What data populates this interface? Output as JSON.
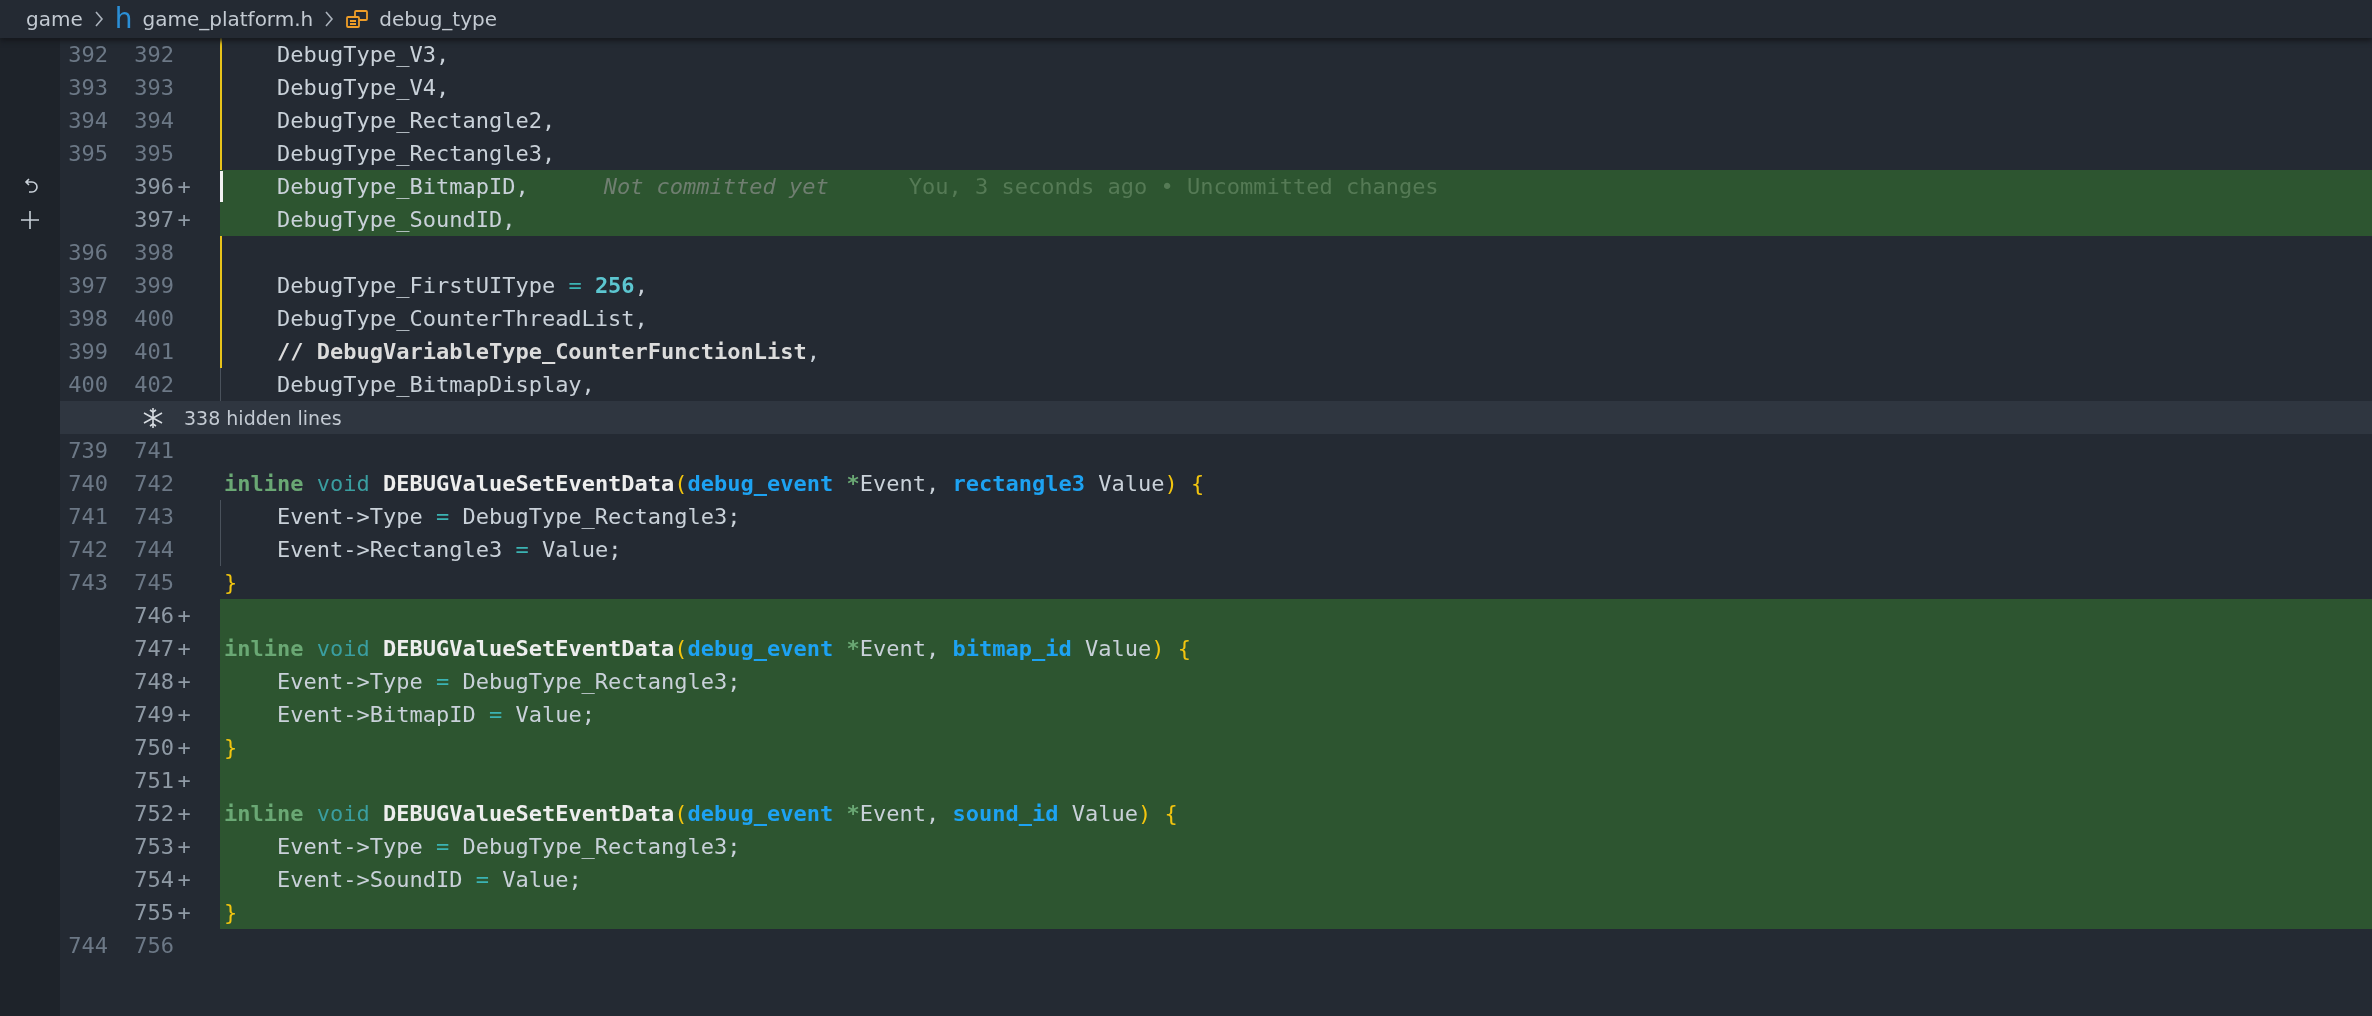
{
  "breadcrumb": [
    {
      "kind": "folder",
      "label": "game"
    },
    {
      "kind": "file",
      "icon_text": "h",
      "label": "game_platform.h"
    },
    {
      "kind": "symbol",
      "label": "debug_type"
    }
  ],
  "rows": [
    {
      "kind": "line",
      "old": "392",
      "new": "392",
      "added": false,
      "modified": true,
      "tokens": [
        {
          "kind": "plain",
          "text": "    DebugType_V3,"
        }
      ]
    },
    {
      "kind": "line",
      "old": "393",
      "new": "393",
      "added": false,
      "modified": true,
      "tokens": [
        {
          "kind": "plain",
          "text": "    DebugType_V4,"
        }
      ]
    },
    {
      "kind": "line",
      "old": "394",
      "new": "394",
      "added": false,
      "modified": true,
      "tokens": [
        {
          "kind": "plain",
          "text": "    DebugType_Rectangle2,"
        }
      ]
    },
    {
      "kind": "line",
      "old": "395",
      "new": "395",
      "added": false,
      "modified": true,
      "tokens": [
        {
          "kind": "plain",
          "text": "    DebugType_Rectangle3,"
        }
      ]
    },
    {
      "kind": "line",
      "new": "396",
      "sign": "+",
      "added": true,
      "cursor": true,
      "revert_action": true,
      "tokens": [
        {
          "kind": "plain",
          "text": "    DebugType_BitmapID,"
        }
      ],
      "blame": {
        "label": "Not committed yet",
        "detail": "You, 3 seconds ago • Uncommitted changes"
      }
    },
    {
      "kind": "line",
      "new": "397",
      "sign": "+",
      "added": true,
      "stage_action": true,
      "tokens": [
        {
          "kind": "plain",
          "text": "    DebugType_SoundID,"
        }
      ]
    },
    {
      "kind": "line",
      "old": "396",
      "new": "398",
      "added": false,
      "modified": true
    },
    {
      "kind": "line",
      "old": "397",
      "new": "399",
      "added": false,
      "modified": true,
      "tokens": [
        {
          "kind": "plain",
          "text": "    DebugType_FirstUIType "
        },
        {
          "kind": "op",
          "text": "= "
        },
        {
          "kind": "number",
          "text": "256"
        },
        {
          "kind": "plain",
          "text": ","
        }
      ]
    },
    {
      "kind": "line",
      "old": "398",
      "new": "400",
      "added": false,
      "modified": true,
      "tokens": [
        {
          "kind": "plain",
          "text": "    DebugType_CounterThreadList,"
        }
      ]
    },
    {
      "kind": "line",
      "old": "399",
      "new": "401",
      "added": false,
      "modified": true,
      "tokens": [
        {
          "kind": "comment",
          "text": "    // DebugVariableType_CounterFunctionList"
        },
        {
          "kind": "plain",
          "text": ","
        }
      ]
    },
    {
      "kind": "line",
      "old": "400",
      "new": "402",
      "added": false,
      "indent_guide": true,
      "tokens": [
        {
          "kind": "plain",
          "text": "    DebugType_BitmapDisplay,"
        }
      ]
    },
    {
      "kind": "fold",
      "label": "338 hidden lines"
    },
    {
      "kind": "line",
      "old": "739",
      "new": "741",
      "added": false
    },
    {
      "kind": "line",
      "old": "740",
      "new": "742",
      "added": false,
      "tokens": [
        {
          "kind": "keyword",
          "text": "inline "
        },
        {
          "kind": "storage",
          "text": "void "
        },
        {
          "kind": "func",
          "text": "DEBUGValueSetEventData"
        },
        {
          "kind": "paren",
          "text": "("
        },
        {
          "kind": "type",
          "text": "debug_event "
        },
        {
          "kind": "pointer",
          "text": "*"
        },
        {
          "kind": "plain",
          "text": "Event, "
        },
        {
          "kind": "type",
          "text": "rectangle3"
        },
        {
          "kind": "plain",
          "text": " Value"
        },
        {
          "kind": "paren",
          "text": ") {"
        }
      ]
    },
    {
      "kind": "line",
      "old": "741",
      "new": "743",
      "added": false,
      "indent_guide": true,
      "tokens": [
        {
          "kind": "plain",
          "text": "    Event->Type "
        },
        {
          "kind": "op",
          "text": "="
        },
        {
          "kind": "plain",
          "text": " DebugType_Rectangle3;"
        }
      ]
    },
    {
      "kind": "line",
      "old": "742",
      "new": "744",
      "added": false,
      "indent_guide": true,
      "tokens": [
        {
          "kind": "plain",
          "text": "    Event->Rectangle3 "
        },
        {
          "kind": "op",
          "text": "="
        },
        {
          "kind": "plain",
          "text": " Value;"
        }
      ]
    },
    {
      "kind": "line",
      "old": "743",
      "new": "745",
      "added": false,
      "tokens": [
        {
          "kind": "paren",
          "text": "}"
        }
      ]
    },
    {
      "kind": "line",
      "new": "746",
      "sign": "+",
      "added": true
    },
    {
      "kind": "line",
      "new": "747",
      "sign": "+",
      "added": true,
      "tokens": [
        {
          "kind": "keyword",
          "text": "inline "
        },
        {
          "kind": "storage",
          "text": "void "
        },
        {
          "kind": "func",
          "text": "DEBUGValueSetEventData"
        },
        {
          "kind": "paren",
          "text": "("
        },
        {
          "kind": "type",
          "text": "debug_event "
        },
        {
          "kind": "pointer",
          "text": "*"
        },
        {
          "kind": "plain",
          "text": "Event, "
        },
        {
          "kind": "type",
          "text": "bitmap_id"
        },
        {
          "kind": "plain",
          "text": " Value"
        },
        {
          "kind": "paren",
          "text": ") {"
        }
      ]
    },
    {
      "kind": "line",
      "new": "748",
      "sign": "+",
      "added": true,
      "tokens": [
        {
          "kind": "plain",
          "text": "    Event->Type "
        },
        {
          "kind": "op",
          "text": "="
        },
        {
          "kind": "plain",
          "text": " DebugType_Rectangle3;"
        }
      ]
    },
    {
      "kind": "line",
      "new": "749",
      "sign": "+",
      "added": true,
      "tokens": [
        {
          "kind": "plain",
          "text": "    Event->BitmapID "
        },
        {
          "kind": "op",
          "text": "="
        },
        {
          "kind": "plain",
          "text": " Value;"
        }
      ]
    },
    {
      "kind": "line",
      "new": "750",
      "sign": "+",
      "added": true,
      "tokens": [
        {
          "kind": "paren",
          "text": "}"
        }
      ]
    },
    {
      "kind": "line",
      "new": "751",
      "sign": "+",
      "added": true
    },
    {
      "kind": "line",
      "new": "752",
      "sign": "+",
      "added": true,
      "tokens": [
        {
          "kind": "keyword",
          "text": "inline "
        },
        {
          "kind": "storage",
          "text": "void "
        },
        {
          "kind": "func",
          "text": "DEBUGValueSetEventData"
        },
        {
          "kind": "paren",
          "text": "("
        },
        {
          "kind": "type",
          "text": "debug_event "
        },
        {
          "kind": "pointer",
          "text": "*"
        },
        {
          "kind": "plain",
          "text": "Event, "
        },
        {
          "kind": "type",
          "text": "sound_id"
        },
        {
          "kind": "plain",
          "text": " Value"
        },
        {
          "kind": "paren",
          "text": ") {"
        }
      ]
    },
    {
      "kind": "line",
      "new": "753",
      "sign": "+",
      "added": true,
      "tokens": [
        {
          "kind": "plain",
          "text": "    Event->Type "
        },
        {
          "kind": "op",
          "text": "="
        },
        {
          "kind": "plain",
          "text": " DebugType_Rectangle3;"
        }
      ]
    },
    {
      "kind": "line",
      "new": "754",
      "sign": "+",
      "added": true,
      "tokens": [
        {
          "kind": "plain",
          "text": "    Event->SoundID "
        },
        {
          "kind": "op",
          "text": "="
        },
        {
          "kind": "plain",
          "text": " Value;"
        }
      ]
    },
    {
      "kind": "line",
      "new": "755",
      "sign": "+",
      "added": true,
      "tokens": [
        {
          "kind": "paren",
          "text": "}"
        }
      ]
    },
    {
      "kind": "line",
      "old": "744",
      "new": "756",
      "added": false
    }
  ]
}
